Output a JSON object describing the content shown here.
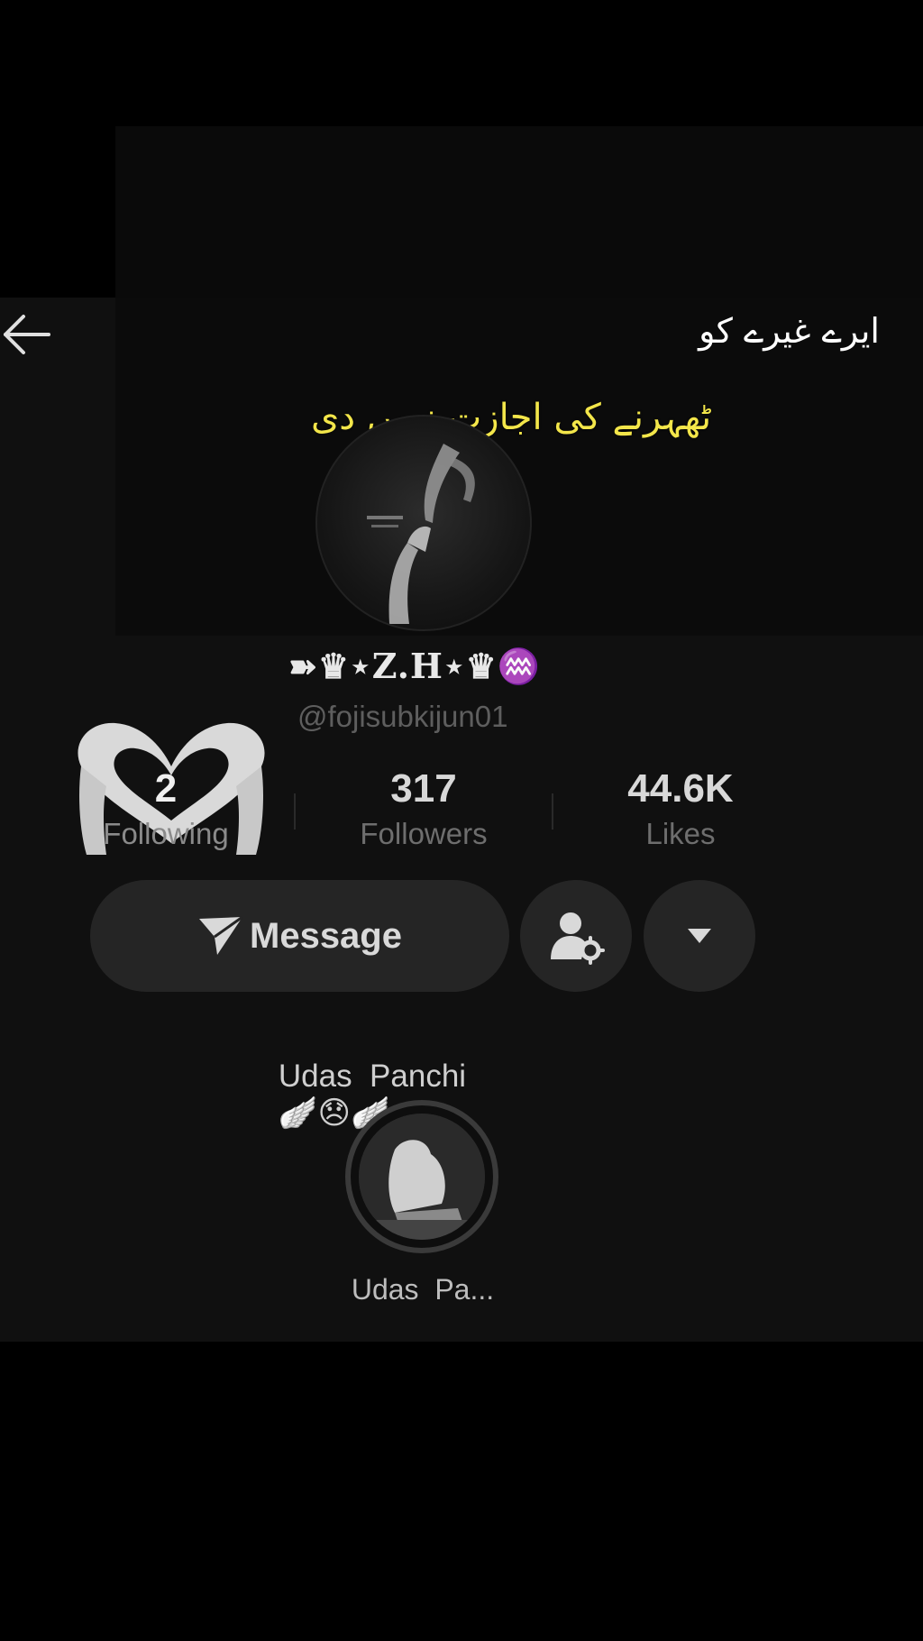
{
  "overlay": {
    "line1": "ایرے غیرے کو",
    "line2": "ٹھہرنے کی اجازت نہیں دی"
  },
  "profile": {
    "display_name": "➽♛⋆Z.H⋆♛♒",
    "username": "@fojisubkijun01",
    "bio": "Udas  Panchi",
    "bio_emojis": "🪽😞🪽"
  },
  "stats": {
    "following": {
      "value": "2",
      "label": "Following"
    },
    "followers": {
      "value": "317",
      "label": "Followers"
    },
    "likes": {
      "value": "44.6K",
      "label": "Likes"
    }
  },
  "actions": {
    "message_label": "Message"
  },
  "highlights": [
    {
      "label": "Udas  Pa..."
    }
  ],
  "colors": {
    "background": "#000000",
    "panel": "#101010",
    "button": "#252525",
    "overlay_accent": "#f3e64a"
  }
}
